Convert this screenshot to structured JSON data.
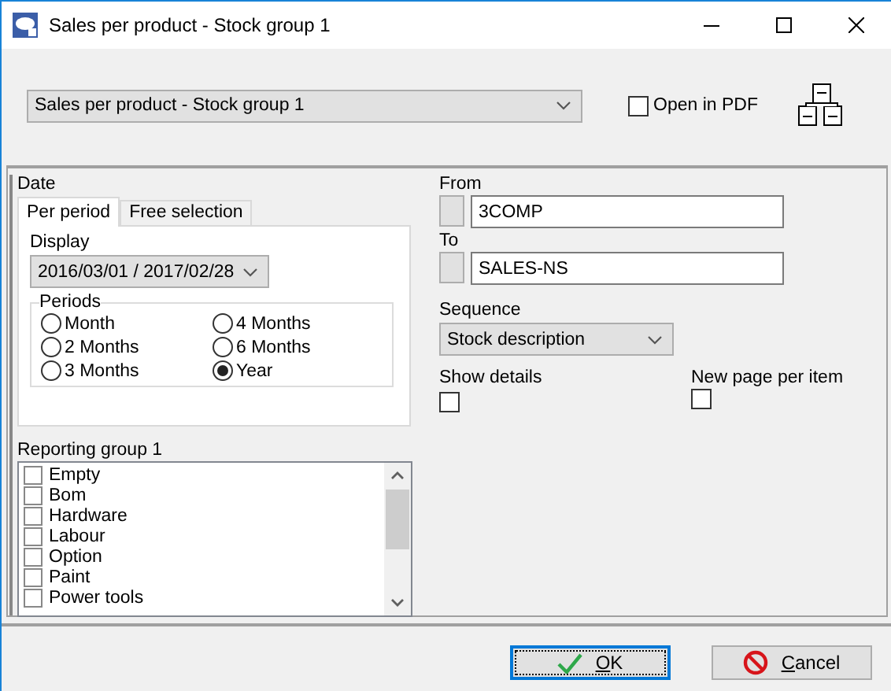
{
  "window": {
    "title": "Sales per product - Stock group 1"
  },
  "report": {
    "value": "Sales per product - Stock group 1"
  },
  "open_in_pdf": {
    "label": "Open in PDF",
    "checked": false
  },
  "date": {
    "label": "Date",
    "tabs": [
      {
        "label": "Per period",
        "selected": true
      },
      {
        "label": "Free selection",
        "selected": false
      }
    ],
    "display": {
      "label": "Display",
      "value": "2016/03/01 / 2017/02/28"
    },
    "periods": {
      "label": "Periods",
      "options": [
        {
          "label": "Month",
          "selected": false
        },
        {
          "label": "2 Months",
          "selected": false
        },
        {
          "label": "3 Months",
          "selected": false
        },
        {
          "label": "4 Months",
          "selected": false
        },
        {
          "label": "6 Months",
          "selected": false
        },
        {
          "label": "Year",
          "selected": true
        }
      ]
    }
  },
  "reporting_group": {
    "label": "Reporting group 1",
    "items": [
      {
        "label": "Empty",
        "checked": false
      },
      {
        "label": "Bom",
        "checked": false
      },
      {
        "label": "Hardware",
        "checked": false
      },
      {
        "label": "Labour",
        "checked": false
      },
      {
        "label": "Option",
        "checked": false
      },
      {
        "label": "Paint",
        "checked": false
      },
      {
        "label": "Power tools",
        "checked": false
      }
    ]
  },
  "from": {
    "label": "From",
    "value": "3COMP"
  },
  "to": {
    "label": "To",
    "value": "SALES-NS"
  },
  "sequence": {
    "label": "Sequence",
    "value": "Stock description"
  },
  "show_details": {
    "label": "Show details",
    "checked": false
  },
  "new_page_per_item": {
    "label": "New page per item",
    "checked": false
  },
  "buttons": [
    {
      "label": "OK",
      "kind": "ok",
      "default": true
    },
    {
      "label": "Cancel",
      "kind": "cancel",
      "default": false
    }
  ]
}
